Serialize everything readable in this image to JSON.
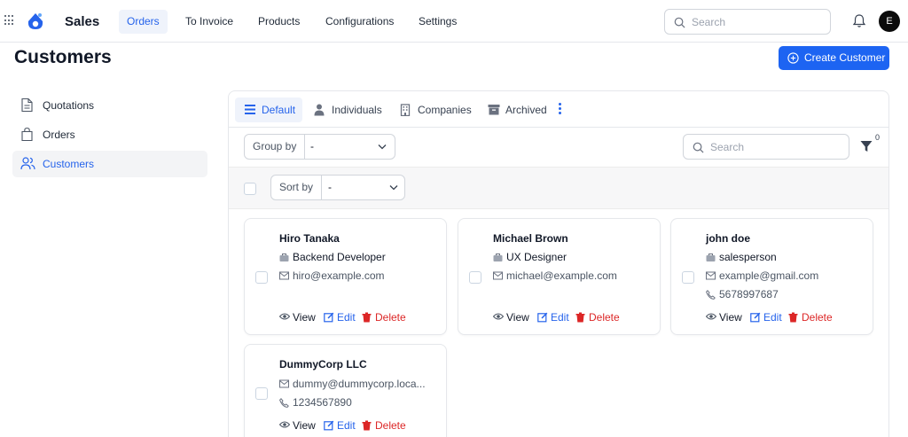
{
  "app": {
    "title": "Sales",
    "avatar_initial": "E"
  },
  "nav": {
    "items": [
      {
        "label": "Orders",
        "active": true
      },
      {
        "label": "To Invoice"
      },
      {
        "label": "Products"
      },
      {
        "label": "Configurations"
      },
      {
        "label": "Settings"
      }
    ],
    "search_placeholder": "Search"
  },
  "page": {
    "title": "Customers",
    "create_label": "Create Customer"
  },
  "sidebar": {
    "items": [
      {
        "label": "Quotations",
        "icon": "document-icon"
      },
      {
        "label": "Orders",
        "icon": "shopping-bag-icon"
      },
      {
        "label": "Customers",
        "icon": "users-icon",
        "active": true
      }
    ]
  },
  "views": {
    "tabs": [
      {
        "label": "Default",
        "icon": "list-icon",
        "active": true
      },
      {
        "label": "Individuals",
        "icon": "person-icon"
      },
      {
        "label": "Companies",
        "icon": "building-icon"
      },
      {
        "label": "Archived",
        "icon": "archive-icon"
      }
    ]
  },
  "toolbar": {
    "group_by_label": "Group by",
    "group_by_value": "-",
    "search_placeholder": "Search",
    "filter_count": "0",
    "sort_by_label": "Sort by",
    "sort_by_value": "-"
  },
  "actions": {
    "view": "View",
    "edit": "Edit",
    "delete": "Delete"
  },
  "customers": [
    {
      "name": "Hiro Tanaka",
      "role": "Backend Developer",
      "email": "hiro@example.com",
      "phone": ""
    },
    {
      "name": "Michael Brown",
      "role": "UX Designer",
      "email": "michael@example.com",
      "phone": ""
    },
    {
      "name": "john doe",
      "role": "salesperson",
      "email": "example@gmail.com",
      "phone": "5678997687"
    },
    {
      "name": "DummyCorp LLC",
      "role": "",
      "email": "dummy@dummycorp.loca...",
      "phone": "1234567890"
    }
  ],
  "colors": {
    "accent": "#1d64f2",
    "danger": "#dc2626",
    "active_bg": "#eff3fb"
  }
}
